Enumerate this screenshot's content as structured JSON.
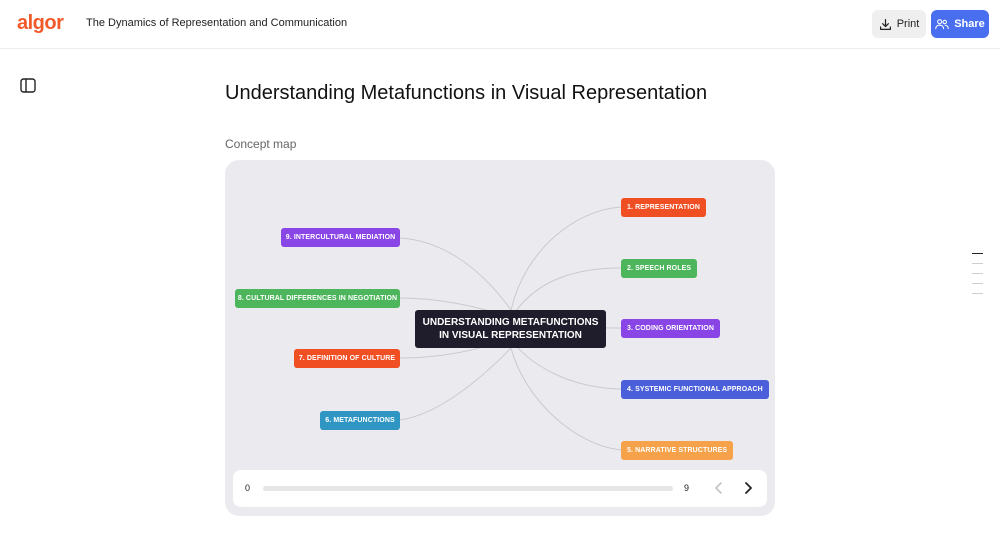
{
  "header": {
    "logo_text": "algor",
    "document_title": "The Dynamics of Representation and Communication",
    "print_label": "Print",
    "share_label": "Share"
  },
  "main": {
    "page_title": "Understanding Metafunctions in Visual Representation",
    "section_label": "Concept map"
  },
  "concept_map": {
    "center": "UNDERSTANDING METAFUNCTIONS IN VISUAL REPRESENTATION",
    "nodes": [
      {
        "label": "1. REPRESENTATION",
        "color": "#f04e23"
      },
      {
        "label": "2. SPEECH ROLES",
        "color": "#4db55b"
      },
      {
        "label": "3. CODING ORIENTATION",
        "color": "#8a45e6"
      },
      {
        "label": "4. SYSTEMIC FUNCTIONAL APPROACH",
        "color": "#4a5fd9"
      },
      {
        "label": "5. NARRATIVE STRUCTURES",
        "color": "#f5a24a"
      },
      {
        "label": "6. METAFUNCTIONS",
        "color": "#2f96c4"
      },
      {
        "label": "7. DEFINITION OF CULTURE",
        "color": "#f04e23"
      },
      {
        "label": "8. CULTURAL DIFFERENCES IN NEGOTIATION",
        "color": "#4db55b"
      },
      {
        "label": "9. INTERCULTURAL MEDIATION",
        "color": "#8a45e6"
      }
    ]
  },
  "slider": {
    "min": "0",
    "max": "9"
  }
}
